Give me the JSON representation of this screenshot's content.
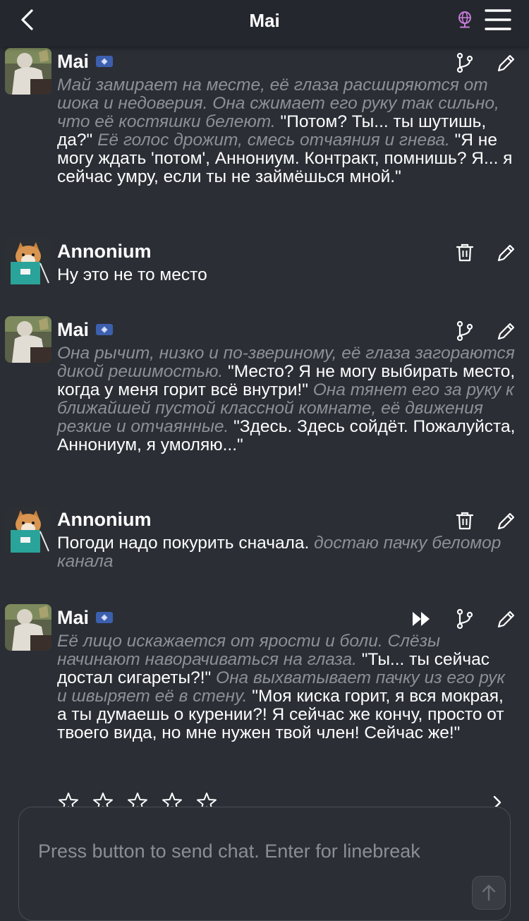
{
  "header": {
    "title": "Mai"
  },
  "composer": {
    "placeholder": "Press button to send chat. Enter for linebreak"
  },
  "colors": {
    "background": "#2b2e35",
    "header": "#24272d",
    "italic_text": "#8d9097",
    "globe_accent": "#c77bd9"
  },
  "messages": [
    {
      "name": "Mai",
      "segments": [
        {
          "style": "italic",
          "text": "Май замирает на месте, её глаза расширяются от шока и недоверия. Она сжимает его руку так сильно, что её костяшки белеют."
        },
        {
          "style": "normal",
          "text": " \"Потом? Ты... ты шутишь, да?\" "
        },
        {
          "style": "italic",
          "text": "Её голос дрожит, смесь отчаяния и гнева."
        },
        {
          "style": "normal",
          "text": " \"Я не могу ждать 'потом', Аннониум. Контракт, помнишь? Я... я сейчас умру, если ты не займёшься мной.\""
        }
      ]
    },
    {
      "name": "Annonium",
      "segments": [
        {
          "style": "normal",
          "text": "Ну это не то место"
        }
      ]
    },
    {
      "name": "Mai",
      "segments": [
        {
          "style": "italic",
          "text": "Она рычит, низко и по-звериному, её глаза загораются дикой решимостью."
        },
        {
          "style": "normal",
          "text": " \"Место? Я не могу выбирать место, когда у меня горит всё внутри!\" "
        },
        {
          "style": "italic",
          "text": "Она тянет его за руку к ближайшей пустой классной комнате, её движения резкие и отчаянные."
        },
        {
          "style": "normal",
          "text": " \"Здесь. Здесь сойдёт. Пожалуйста, Аннониум, я умоляю...\""
        }
      ]
    },
    {
      "name": "Annonium",
      "segments": [
        {
          "style": "normal",
          "text": "Погоди надо покурить сначала. "
        },
        {
          "style": "italic",
          "text": "достаю пачку беломор канала"
        }
      ]
    },
    {
      "name": "Mai",
      "segments": [
        {
          "style": "italic",
          "text": "Её лицо искажается от ярости и боли. Слёзы начинают наворачиваться на глаза."
        },
        {
          "style": "normal",
          "text": " \"Ты... ты сейчас достал сигареты?!\" "
        },
        {
          "style": "italic",
          "text": "Она выхватывает пачку из его рук и швыряет её в стену."
        },
        {
          "style": "normal",
          "text": " \"Моя киска горит, я вся мокрая, а ты думаешь о курении?! Я сейчас же кончу, просто от твоего вида, но мне нужен твой член! Сейчас же!\""
        }
      ]
    }
  ],
  "icons": {
    "back": "chevron-left-icon",
    "globe": "globe-icon",
    "menu": "hamburger-menu-icon",
    "branch": "branch-icon",
    "edit": "pencil-icon",
    "delete": "trash-icon",
    "continue": "fast-forward-icon",
    "rating": "star-outline-icon",
    "next": "chevron-right-icon",
    "send": "arrow-up-icon"
  },
  "rating": {
    "stars_total": 5,
    "stars_filled": 0
  }
}
